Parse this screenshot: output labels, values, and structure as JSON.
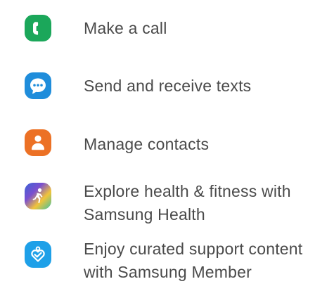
{
  "items": [
    {
      "icon": "phone-icon",
      "color": "#1ba75a",
      "lines": [
        "Make a call"
      ]
    },
    {
      "icon": "chat-bubble-icon",
      "color": "#1f8ddb",
      "lines": [
        "Send and receive texts"
      ]
    },
    {
      "icon": "contact-person-icon",
      "color": "#ec7125",
      "lines": [
        "Manage contacts"
      ]
    },
    {
      "icon": "samsung-health-runner-icon",
      "color": "#6a5fd0",
      "lines": [
        "Explore health & fitness with",
        "Samsung Health"
      ]
    },
    {
      "icon": "samsung-members-heart-icon",
      "color": "#1ea0e8",
      "lines": [
        "Enjoy curated support content",
        "with Samsung Member"
      ]
    }
  ]
}
